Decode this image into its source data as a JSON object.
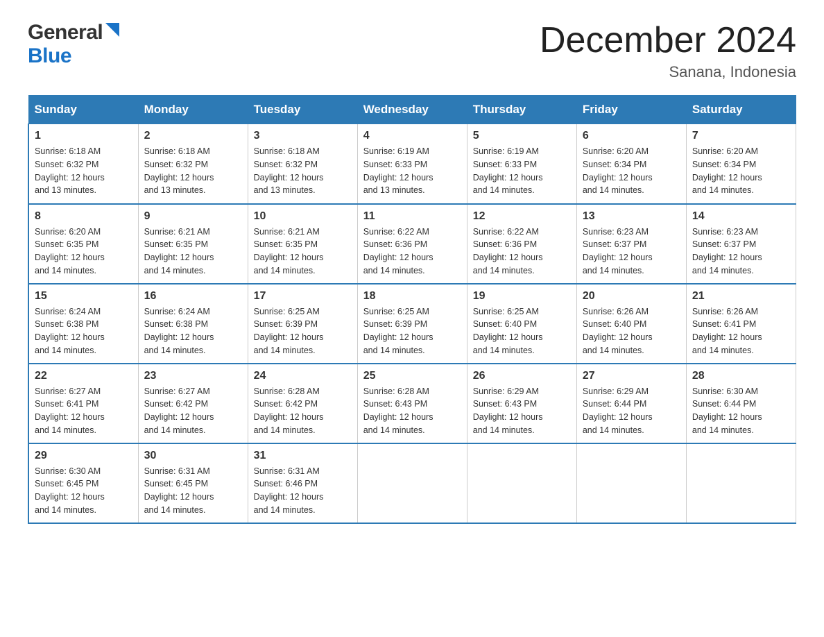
{
  "logo": {
    "general": "General",
    "blue": "Blue"
  },
  "title": "December 2024",
  "subtitle": "Sanana, Indonesia",
  "days_of_week": [
    "Sunday",
    "Monday",
    "Tuesday",
    "Wednesday",
    "Thursday",
    "Friday",
    "Saturday"
  ],
  "weeks": [
    [
      {
        "day": "1",
        "sunrise": "6:18 AM",
        "sunset": "6:32 PM",
        "daylight": "12 hours and 13 minutes."
      },
      {
        "day": "2",
        "sunrise": "6:18 AM",
        "sunset": "6:32 PM",
        "daylight": "12 hours and 13 minutes."
      },
      {
        "day": "3",
        "sunrise": "6:18 AM",
        "sunset": "6:32 PM",
        "daylight": "12 hours and 13 minutes."
      },
      {
        "day": "4",
        "sunrise": "6:19 AM",
        "sunset": "6:33 PM",
        "daylight": "12 hours and 13 minutes."
      },
      {
        "day": "5",
        "sunrise": "6:19 AM",
        "sunset": "6:33 PM",
        "daylight": "12 hours and 14 minutes."
      },
      {
        "day": "6",
        "sunrise": "6:20 AM",
        "sunset": "6:34 PM",
        "daylight": "12 hours and 14 minutes."
      },
      {
        "day": "7",
        "sunrise": "6:20 AM",
        "sunset": "6:34 PM",
        "daylight": "12 hours and 14 minutes."
      }
    ],
    [
      {
        "day": "8",
        "sunrise": "6:20 AM",
        "sunset": "6:35 PM",
        "daylight": "12 hours and 14 minutes."
      },
      {
        "day": "9",
        "sunrise": "6:21 AM",
        "sunset": "6:35 PM",
        "daylight": "12 hours and 14 minutes."
      },
      {
        "day": "10",
        "sunrise": "6:21 AM",
        "sunset": "6:35 PM",
        "daylight": "12 hours and 14 minutes."
      },
      {
        "day": "11",
        "sunrise": "6:22 AM",
        "sunset": "6:36 PM",
        "daylight": "12 hours and 14 minutes."
      },
      {
        "day": "12",
        "sunrise": "6:22 AM",
        "sunset": "6:36 PM",
        "daylight": "12 hours and 14 minutes."
      },
      {
        "day": "13",
        "sunrise": "6:23 AM",
        "sunset": "6:37 PM",
        "daylight": "12 hours and 14 minutes."
      },
      {
        "day": "14",
        "sunrise": "6:23 AM",
        "sunset": "6:37 PM",
        "daylight": "12 hours and 14 minutes."
      }
    ],
    [
      {
        "day": "15",
        "sunrise": "6:24 AM",
        "sunset": "6:38 PM",
        "daylight": "12 hours and 14 minutes."
      },
      {
        "day": "16",
        "sunrise": "6:24 AM",
        "sunset": "6:38 PM",
        "daylight": "12 hours and 14 minutes."
      },
      {
        "day": "17",
        "sunrise": "6:25 AM",
        "sunset": "6:39 PM",
        "daylight": "12 hours and 14 minutes."
      },
      {
        "day": "18",
        "sunrise": "6:25 AM",
        "sunset": "6:39 PM",
        "daylight": "12 hours and 14 minutes."
      },
      {
        "day": "19",
        "sunrise": "6:25 AM",
        "sunset": "6:40 PM",
        "daylight": "12 hours and 14 minutes."
      },
      {
        "day": "20",
        "sunrise": "6:26 AM",
        "sunset": "6:40 PM",
        "daylight": "12 hours and 14 minutes."
      },
      {
        "day": "21",
        "sunrise": "6:26 AM",
        "sunset": "6:41 PM",
        "daylight": "12 hours and 14 minutes."
      }
    ],
    [
      {
        "day": "22",
        "sunrise": "6:27 AM",
        "sunset": "6:41 PM",
        "daylight": "12 hours and 14 minutes."
      },
      {
        "day": "23",
        "sunrise": "6:27 AM",
        "sunset": "6:42 PM",
        "daylight": "12 hours and 14 minutes."
      },
      {
        "day": "24",
        "sunrise": "6:28 AM",
        "sunset": "6:42 PM",
        "daylight": "12 hours and 14 minutes."
      },
      {
        "day": "25",
        "sunrise": "6:28 AM",
        "sunset": "6:43 PM",
        "daylight": "12 hours and 14 minutes."
      },
      {
        "day": "26",
        "sunrise": "6:29 AM",
        "sunset": "6:43 PM",
        "daylight": "12 hours and 14 minutes."
      },
      {
        "day": "27",
        "sunrise": "6:29 AM",
        "sunset": "6:44 PM",
        "daylight": "12 hours and 14 minutes."
      },
      {
        "day": "28",
        "sunrise": "6:30 AM",
        "sunset": "6:44 PM",
        "daylight": "12 hours and 14 minutes."
      }
    ],
    [
      {
        "day": "29",
        "sunrise": "6:30 AM",
        "sunset": "6:45 PM",
        "daylight": "12 hours and 14 minutes."
      },
      {
        "day": "30",
        "sunrise": "6:31 AM",
        "sunset": "6:45 PM",
        "daylight": "12 hours and 14 minutes."
      },
      {
        "day": "31",
        "sunrise": "6:31 AM",
        "sunset": "6:46 PM",
        "daylight": "12 hours and 14 minutes."
      },
      null,
      null,
      null,
      null
    ]
  ],
  "labels": {
    "sunrise": "Sunrise:",
    "sunset": "Sunset:",
    "daylight": "Daylight:"
  }
}
